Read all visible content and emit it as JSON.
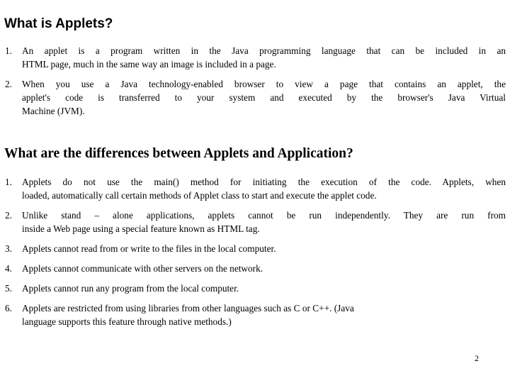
{
  "page": {
    "number": "2",
    "background_color": "#ffffff",
    "text_color": "#000000"
  },
  "section1": {
    "heading": "What is Applets?",
    "items": [
      {
        "marker": "1.",
        "lines": [
          "An applet is a program written in the Java programming language that can be included in an",
          "HTML page, much in the same way an image is included in a page."
        ],
        "text": "An applet is a program written in the Java programming language that can be included in an HTML page, much in the same way an image is included in a page."
      },
      {
        "marker": "2.",
        "lines": [
          "When you use a Java technology-enabled browser to view a page that contains an applet, the",
          "applet's code is transferred to your system and executed by the browser's Java Virtual",
          "Machine (JVM)."
        ],
        "text": "When you use a Java technology-enabled browser to view a page that contains an applet, the applet's code is transferred to your system and executed by the browser's Java Virtual Machine (JVM)."
      }
    ]
  },
  "section2": {
    "heading": "What are the differences between Applets and Application?",
    "items": [
      {
        "marker": "1.",
        "lines": [
          "Applets do not use the main() method for initiating the execution of the code. Applets, when",
          "loaded, automatically call certain methods of Applet class to start and execute the applet code."
        ],
        "text": "Applets do not use the main() method for initiating the execution of the code. Applets, when loaded, automatically call certain methods of Applet class to start and execute the applet code."
      },
      {
        "marker": "2.",
        "lines": [
          "Unlike stand – alone applications, applets cannot be run independently. They are run from",
          "inside a Web page using a special feature known as HTML tag."
        ],
        "text": "Unlike stand – alone applications, applets cannot be run independently. They are run from inside a Web page using a special feature known as HTML tag."
      },
      {
        "marker": "3.",
        "lines": [
          "Applets cannot read from or write to the files in the local computer."
        ],
        "text": "Applets cannot read from or write to the files in the local computer."
      },
      {
        "marker": "4.",
        "lines": [
          "Applets cannot communicate with other servers on the network."
        ],
        "text": "Applets cannot communicate with other servers on the network."
      },
      {
        "marker": "5.",
        "lines": [
          "Applets cannot run any program from the local computer."
        ],
        "text": "Applets cannot run any program from the local computer."
      },
      {
        "marker": "6.",
        "lines": [
          "Applets are restricted from using libraries from other languages such as C or C++. (Java",
          "language supports this feature through native methods.)"
        ],
        "text": "Applets are restricted from using libraries from other languages such as C or C++. (Java language supports this feature through native methods.)"
      }
    ]
  }
}
